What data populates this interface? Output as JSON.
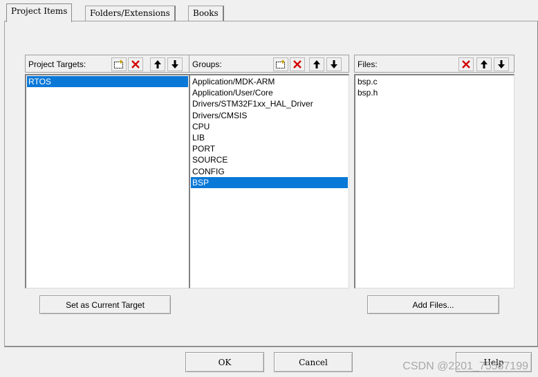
{
  "tabs": [
    {
      "label": "Project Items"
    },
    {
      "label": "Folders/Extensions"
    },
    {
      "label": "Books"
    }
  ],
  "targets": {
    "header": "Project Targets:",
    "items": [
      "RTOS"
    ],
    "selected": "RTOS"
  },
  "groups": {
    "header": "Groups:",
    "items": [
      "Application/MDK-ARM",
      "Application/User/Core",
      "Drivers/STM32F1xx_HAL_Driver",
      "Drivers/CMSIS",
      "CPU",
      "LIB",
      "PORT",
      "SOURCE",
      "CONFIG",
      "BSP"
    ],
    "selected": "BSP"
  },
  "files": {
    "header": "Files:",
    "items": [
      "bsp.c",
      "bsp.h"
    ]
  },
  "buttons": {
    "set_current_target": "Set as Current Target",
    "add_files": "Add Files...",
    "ok": "OK",
    "cancel": "Cancel",
    "help": "Help"
  },
  "watermark": "CSDN @2201_75587199",
  "colors": {
    "selection": "#0a78d7",
    "delete_icon": "#d40000"
  }
}
